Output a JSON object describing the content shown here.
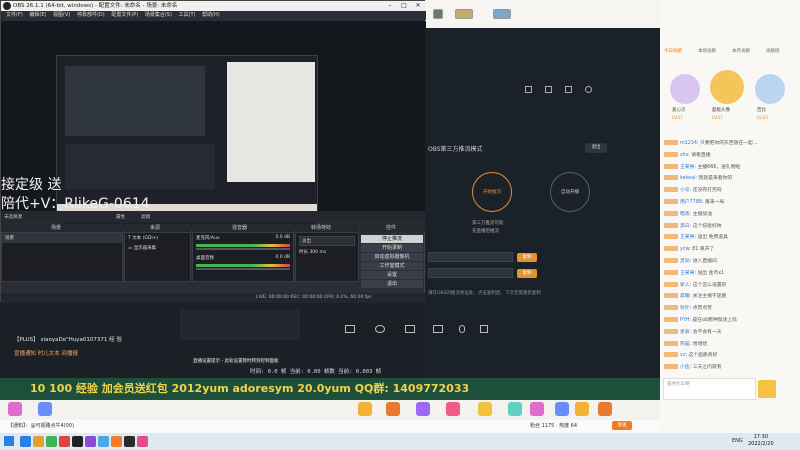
{
  "obs": {
    "title": "OBS 26.1.1 (64-bit, windows) - 配置文件: 未命名 - 场景: 未命名",
    "menu": [
      "文件(F)",
      "编辑(E)",
      "视图(V)",
      "停靠部件(D)",
      "配置文件(P)",
      "场景集合(S)",
      "工具(T)",
      "帮助(H)"
    ],
    "overlay_text": [
      "接定级  送",
      "陪代+V：RlikeG-0614"
    ],
    "no_source": "未选择源",
    "properties_label": "属性",
    "filters_label": "滤镜",
    "docks": {
      "scenes": "场景",
      "sources": "来源",
      "mixer": "混音器",
      "transitions": "转场特效",
      "controls": "控件"
    },
    "scene_list": [
      "场景"
    ],
    "source_list": [
      "文本 (GDI+)",
      "显示器采集"
    ],
    "mixer": [
      {
        "name": "麦克风/Aux",
        "db": "0.0 dB"
      },
      {
        "name": "桌面音频",
        "db": "0.0 dB"
      }
    ],
    "transition": {
      "value": "淡出",
      "duration_label": "时长",
      "duration": "300 ms"
    },
    "controls": [
      "停止推流",
      "开始录制",
      "启动虚拟摄像机",
      "工作室模式",
      "设置",
      "退出"
    ],
    "status": "LIVE: 00:00:00    REC: 00:00:00    CPU: 4.1%, 60.00 fps"
  },
  "third_party": {
    "header": "OBS第三方推流模式",
    "exit_label": "退出",
    "modes": [
      "开始推流",
      "开启推流",
      "自动开播"
    ],
    "mode_notes": [
      "第三方推流可能",
      "先直播后推流"
    ],
    "copy_label": "复制",
    "hint": "请在OBS的推流地址处，点击复制后，下次无需重新复制"
  },
  "stream": {
    "danmu": [
      "【PLUS】 xiaoyaDe\"Huya0107371 经 验",
      "宣播通知 时儿文本 间播报"
    ],
    "stats": "时间: 0.0 帧 当前: 0.00 帧数 当前: 0.003 帧",
    "banner": "10  100  经验 加会员送红包  2012yum  adoresym  20.0yum  QQ群: 1409772033",
    "popup": "直播设置提示 - 此处设置暂时转到控制面板"
  },
  "gift_bar": {
    "notice": "【通知】：@可视路点牛4(00)",
    "room_info": "粉丝 1175 · 热度 64",
    "send": "发送",
    "colors": [
      "#e06bd0",
      "#6b8cff",
      "#f3b233",
      "#e87a2f",
      "#9a6bf2",
      "#ef5a8a",
      "#f2c23d",
      "#5ed1c4"
    ]
  },
  "right_panel": {
    "tabs": [
      "今日贡献",
      "本场贡献",
      "本月贡献",
      "贡献榜"
    ],
    "top_fans": [
      {
        "name": "爱心贝",
        "level": "LV37"
      },
      {
        "name": "超级头像",
        "level": "LV37"
      },
      {
        "name": "芭比",
        "level": "LV33"
      }
    ],
    "chat": [
      {
        "nick": "m1234",
        "text": "只要把你的东西放在一起..."
      },
      {
        "nick": "zhv",
        "text": "请看直播"
      },
      {
        "nick": "王某男",
        "text": "主播666，送礼物啦"
      },
      {
        "nick": "kekeai",
        "text": "我就是来看你的"
      },
      {
        "nick": "小号",
        "text": "还没有打完吗"
      },
      {
        "nick": "用户7788",
        "text": "再来一局"
      },
      {
        "nick": "暗夜",
        "text": "主播加油"
      },
      {
        "nick": "黑白",
        "text": "这个技能好帅"
      },
      {
        "nick": "王某男",
        "text": "送出 免费道具"
      },
      {
        "nick": "ycw",
        "text": "81 离开了"
      },
      {
        "nick": "灵动",
        "text": "进入直播间"
      },
      {
        "nick": "王某男",
        "text": "送出 金币x1"
      },
      {
        "nick": "新人",
        "text": "这个怎么设置的"
      },
      {
        "nick": "晨曦",
        "text": "关注主播不迷路"
      },
      {
        "nick": "秋叶",
        "text": "点赞点赞"
      },
      {
        "nick": "PYH",
        "text": "是在ob那种现场上吗"
      },
      {
        "nick": "星辰",
        "text": "会不会有一天"
      },
      {
        "nick": "熊猫",
        "text": "哈哈哈"
      },
      {
        "nick": "vz",
        "text": "这个画质真好"
      },
      {
        "nick": "小鱼",
        "text": "三天之内就有"
      }
    ],
    "input_placeholder": "说点什么吧",
    "online_label": "当前在线"
  },
  "taskbar": {
    "lang": "ENG",
    "time": "17:30",
    "date": "2022/2/20",
    "app_colors": [
      "#2b7de9",
      "#e0a13a",
      "#3cb55a",
      "#d94545",
      "#222222",
      "#8a4bd6",
      "#4aa8e8",
      "#f07d2b",
      "#2a2a2a",
      "#e34b89"
    ]
  }
}
